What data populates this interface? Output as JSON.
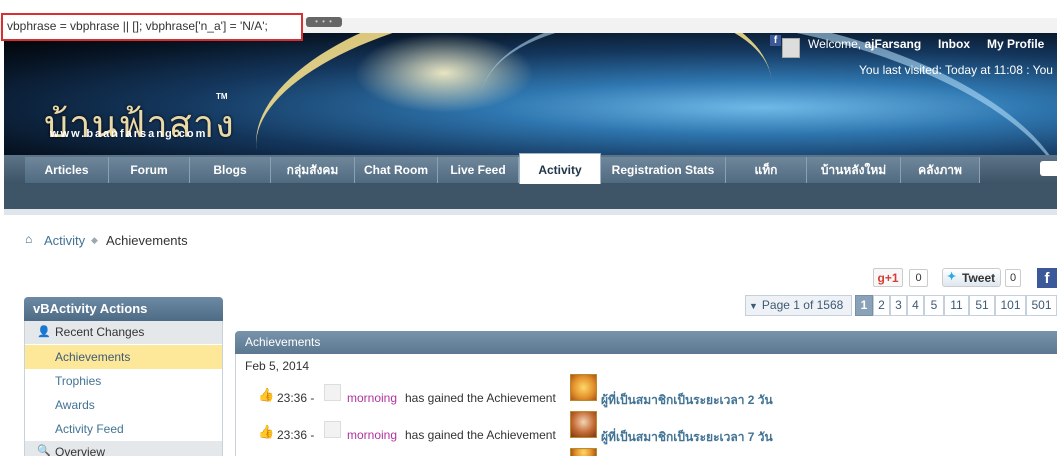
{
  "debug": {
    "text": "vbphrase = vbphrase || []; vbphrase['n_a'] = 'N/A';",
    "tail": "• • •"
  },
  "header": {
    "logo_thai": "บ้านฟ้าสาง",
    "logo_url": "www.baanfarsang.com",
    "logo_tm": "TM",
    "welcome_prefix": "Welcome,",
    "username": "ajFarsang",
    "inbox": "Inbox",
    "my_profile": "My Profile",
    "last_visited": "You last visited: Today at 11:08 : You",
    "fb_letter": "f"
  },
  "nav": {
    "tabs": [
      {
        "label": "Articles"
      },
      {
        "label": "Forum"
      },
      {
        "label": "Blogs"
      },
      {
        "label": "กลุ่มสังคม"
      },
      {
        "label": "Chat Room"
      },
      {
        "label": "Live Feed"
      },
      {
        "label": "Activity"
      },
      {
        "label": "Registration Stats"
      },
      {
        "label": "แท็ก"
      },
      {
        "label": "บ้านหลังใหม่"
      },
      {
        "label": "คลังภาพ"
      }
    ],
    "active_tab": "Activity"
  },
  "breadcrumb": {
    "home_icon": "home-icon",
    "link": "Activity",
    "current": "Achievements"
  },
  "social": {
    "gplus_label": "g+1",
    "gplus_count": "0",
    "tweet_label": "Tweet",
    "tweet_count": "0",
    "fb_letter": "f"
  },
  "pagination": {
    "info": "Page 1 of 1568",
    "pages": [
      "1",
      "2",
      "3",
      "4",
      "5",
      "11",
      "51",
      "101",
      "501"
    ],
    "current": "1"
  },
  "sidebar": {
    "title": "vBActivity Actions",
    "category": "Recent Changes",
    "items": [
      {
        "label": "Achievements"
      },
      {
        "label": "Trophies"
      },
      {
        "label": "Awards"
      },
      {
        "label": "Activity Feed"
      }
    ],
    "active_item": "Achievements",
    "category2": "Overview"
  },
  "main": {
    "title": "Achievements",
    "date": "Feb 5, 2014",
    "activities": [
      {
        "time": "23:36 -",
        "user": "mornoing",
        "text": "has gained the Achievement",
        "achievement": "ผู้ที่เป็นสมาชิกเป็นระยะเวลา 2 วัน"
      },
      {
        "time": "23:36 -",
        "user": "mornoing",
        "text": "has gained the Achievement",
        "achievement": "ผู้ที่เป็นสมาชิกเป็นระยะเวลา 7 วัน"
      }
    ]
  },
  "colors": {
    "link": "#417394",
    "username": "#b0339e",
    "active_sidebar": "#fde89a",
    "highlight_border": "#d9302f"
  }
}
